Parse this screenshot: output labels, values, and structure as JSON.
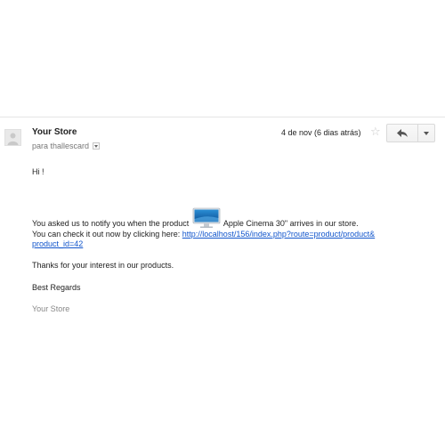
{
  "email": {
    "sender": "Your Store",
    "recipient": "para thallescard",
    "date": "4 de nov (6 dias atrás)",
    "star_icon": "star-outline-icon",
    "reply_icon": "reply-arrow-icon",
    "more_icon": "dropdown-triangle-icon"
  },
  "message": {
    "greeting": "Hi !",
    "notify_prefix": "You asked us to notify you when the product",
    "product_image": "monitor-product-thumbnail",
    "notify_suffix": "Apple Cinema 30\" arrives in our store.",
    "check_prefix": "You can check it out now by clicking here:",
    "link_line1": "http://localhost/156/index.php?route=product/product&",
    "link_line2": "product_id=42",
    "thanks": "Thanks for your interest in our products.",
    "regards": "Best Regards",
    "signature": "Your Store"
  },
  "colors": {
    "link": "#1155cc",
    "signature": "#888888",
    "star": "#c8c8c8"
  }
}
